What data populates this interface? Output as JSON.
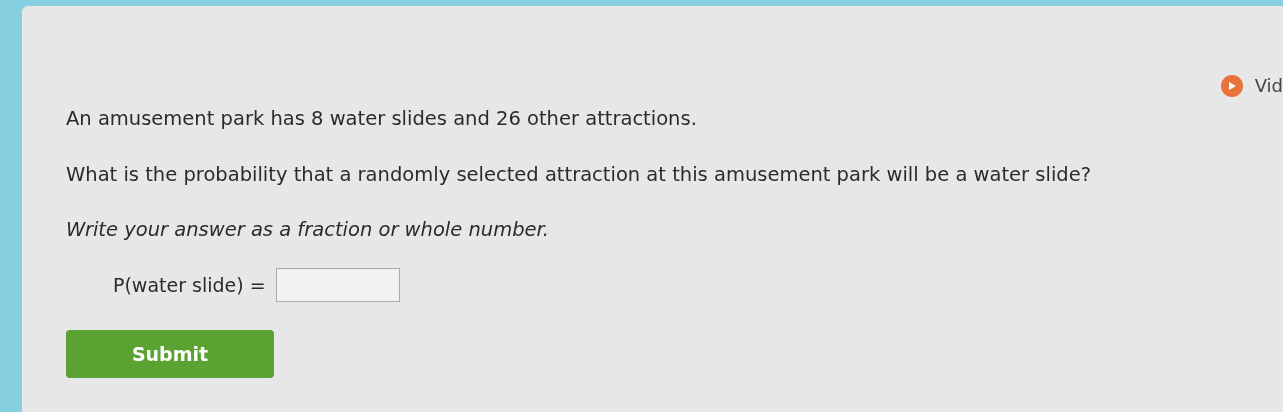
{
  "video_link": {
    "label": "Vid"
  },
  "problem": {
    "statement": "An amusement park has 8 water slides and 26 other attractions.",
    "question": "What is the probability that a randomly selected attraction at this amusement park will be a water slide?",
    "instruction": "Write your answer as a fraction or whole number.",
    "answer_label": "P(water slide) ="
  },
  "submit": {
    "label": "Submit"
  }
}
